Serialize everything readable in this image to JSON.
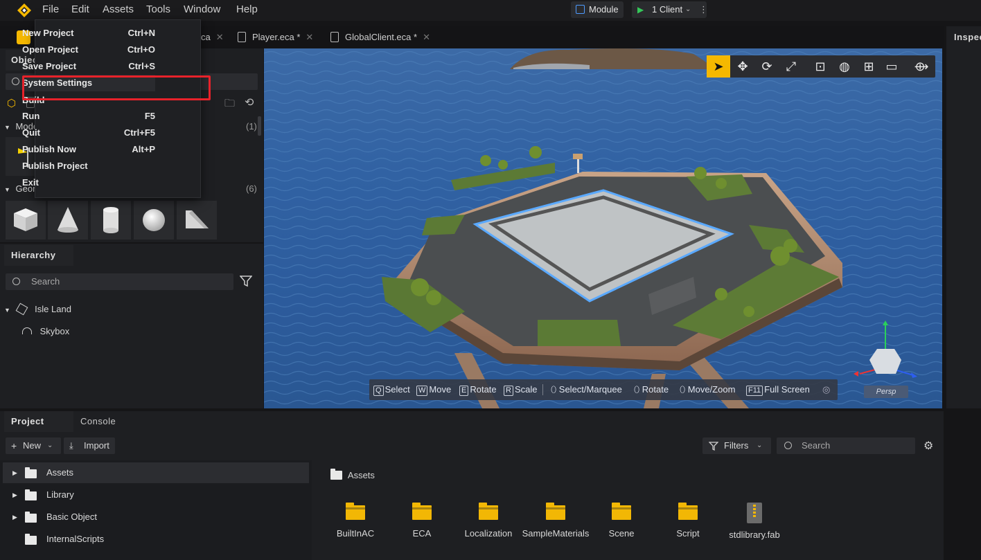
{
  "menubar": {
    "items": [
      "File",
      "Edit",
      "Assets",
      "Tools",
      "Window",
      "Help"
    ],
    "module_label": "Module",
    "client_label": "1 Client"
  },
  "tabs": [
    "ca",
    "Player.eca *",
    "GlobalClient.eca *"
  ],
  "file_menu": {
    "items": [
      {
        "label": "New Project",
        "shortcut": "Ctrl+N"
      },
      {
        "label": "Open Project",
        "shortcut": "Ctrl+O"
      },
      {
        "label": "Save Project",
        "shortcut": "Ctrl+S"
      },
      {
        "label": "System Settings",
        "shortcut": ""
      },
      {
        "label": "Build",
        "shortcut": ""
      },
      {
        "label": "Run",
        "shortcut": "F5"
      },
      {
        "label": "Quit",
        "shortcut": "Ctrl+F5"
      },
      {
        "label": "Publish Now",
        "shortcut": "Alt+P"
      },
      {
        "label": "Publish Project",
        "shortcut": ""
      },
      {
        "label": "Exit",
        "shortcut": ""
      }
    ],
    "highlight_color": "#e8222a"
  },
  "objects_panel": {
    "tab_label": "Objec",
    "search_placeholder": "S",
    "models_label": "Mode",
    "models_count": "(1)",
    "geometry_label": "Geon",
    "geometry_count": "(6)"
  },
  "hierarchy": {
    "tab_label": "Hierarchy",
    "search_placeholder": "Search",
    "items": [
      "Isle Land",
      "Skybox"
    ]
  },
  "viewport": {
    "hints": [
      {
        "key": "Q",
        "label": "Select"
      },
      {
        "key": "W",
        "label": "Move"
      },
      {
        "key": "E",
        "label": "Rotate"
      },
      {
        "key": "R",
        "label": "Scale"
      },
      {
        "key": "",
        "label": "Select/Marquee"
      },
      {
        "key": "",
        "label": "Rotate"
      },
      {
        "key": "",
        "label": "Move/Zoom"
      },
      {
        "key": "F11",
        "label": "Full Screen"
      }
    ],
    "persp_label": "Persp",
    "accent": "#f5b800"
  },
  "inspector": {
    "tab_label": "Inspec"
  },
  "project_panel": {
    "tabs": [
      "Project",
      "Console"
    ],
    "new_label": "New",
    "import_label": "Import",
    "filters_label": "Filters",
    "search_placeholder": "Search",
    "tree": [
      "Assets",
      "Library",
      "Basic Object",
      "InternalScripts"
    ],
    "breadcrumb": "Assets",
    "assets": [
      "BuiltInAC",
      "ECA",
      "Localization",
      "SampleMaterials",
      "Scene",
      "Script",
      "stdlibrary.fab"
    ]
  }
}
